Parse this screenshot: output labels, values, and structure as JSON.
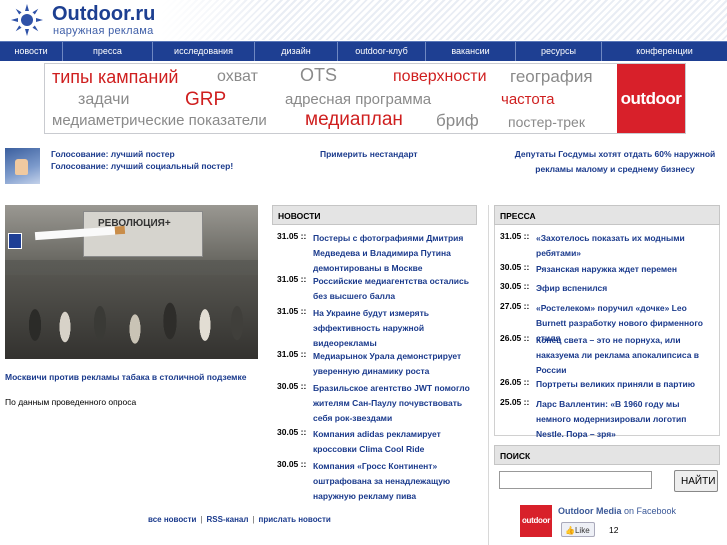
{
  "header": {
    "logo_title": "Outdoor.ru",
    "logo_subtitle": "наружная реклама"
  },
  "nav": [
    "новости",
    "пресса",
    "исследования",
    "дизайн",
    "outdoor-клуб",
    "вакансии",
    "ресурсы",
    "конференции"
  ],
  "banner": {
    "tags": [
      "типы кампаний",
      "охват",
      "OTS",
      "поверхности",
      "география",
      "задачи",
      "GRP",
      "адресная программа",
      "частота",
      "медиаметрические показатели",
      "медиаплан",
      "бриф",
      "постер-трек"
    ],
    "logo": "outdoor"
  },
  "top_links": {
    "left": [
      "Голосование: лучший постер",
      "Голосование: лучший социальный постер!"
    ],
    "center": "Примерить нестандарт",
    "right": "Депутаты Госдумы хотят отдать 60% наружной рекламы малому и среднему бизнесу"
  },
  "photo": {
    "poster_text": "РЕВОЛЮЦИЯ+",
    "caption": "Москвичи против рекламы табака в столичной подземке",
    "note": "По данным проведенного опроса"
  },
  "news": {
    "title": "НОВОСТИ",
    "items": [
      {
        "date": "31.05 ::",
        "text": "Постеры с фотографиями Дмитрия Медведева и Владимира Путина демонтированы в Москве"
      },
      {
        "date": "31.05 ::",
        "text": "Российские медиагентства остались без высшего балла"
      },
      {
        "date": "31.05 ::",
        "text": "На Украине будут измерять эффективность наружной видеорекламы"
      },
      {
        "date": "31.05 ::",
        "text": "Медиарынок Урала демонстрирует уверенную динамику роста"
      },
      {
        "date": "30.05 ::",
        "text": "Бразильское агентство JWT помогло жителям Сан-Паулу почувствовать себя рок-звездами"
      },
      {
        "date": "30.05 ::",
        "text": "Компания adidas рекламирует кроссовки Clima Cool Ride"
      },
      {
        "date": "30.05 ::",
        "text": "Компания «Гросс Континент» оштрафована за ненадлежащую наружную рекламу пива"
      }
    ],
    "footer": [
      "все новости",
      "RSS-канал",
      "прислать новости"
    ]
  },
  "press": {
    "title": "ПРЕССА",
    "items": [
      {
        "date": "31.05 ::",
        "text": "«Захотелось показать их модными ребятами»"
      },
      {
        "date": "30.05 ::",
        "text": "Рязанская наружка ждет перемен"
      },
      {
        "date": "30.05 ::",
        "text": "Эфир вспенился"
      },
      {
        "date": "27.05 ::",
        "text": "«Ростелеком» поручил «дочке» Leo Burnett разработку нового фирменного стиля"
      },
      {
        "date": "26.05 ::",
        "text": "Конец света – это не порнуха, или наказуема ли реклама апокалипсиса в России"
      },
      {
        "date": "26.05 ::",
        "text": "Портреты великих приняли в партию"
      },
      {
        "date": "25.05 ::",
        "text": "Ларс Валлентин: «В 1960 году мы немного модернизировали логотип Nestle. Пора – зря»"
      }
    ]
  },
  "search": {
    "title": "ПОИСК",
    "value": "",
    "button": "НАЙТИ"
  },
  "facebook": {
    "logo": "outdoor",
    "page_name": "Outdoor Media",
    "suffix": "on Facebook",
    "like_label": "Like",
    "like_count": "12"
  },
  "colors": {
    "nav_bg": "#1e3f92",
    "link": "#1a3a8c",
    "brand_red": "#d8202a",
    "tag_red": "#cf1f1f",
    "tag_gray": "#8a8a8a"
  }
}
